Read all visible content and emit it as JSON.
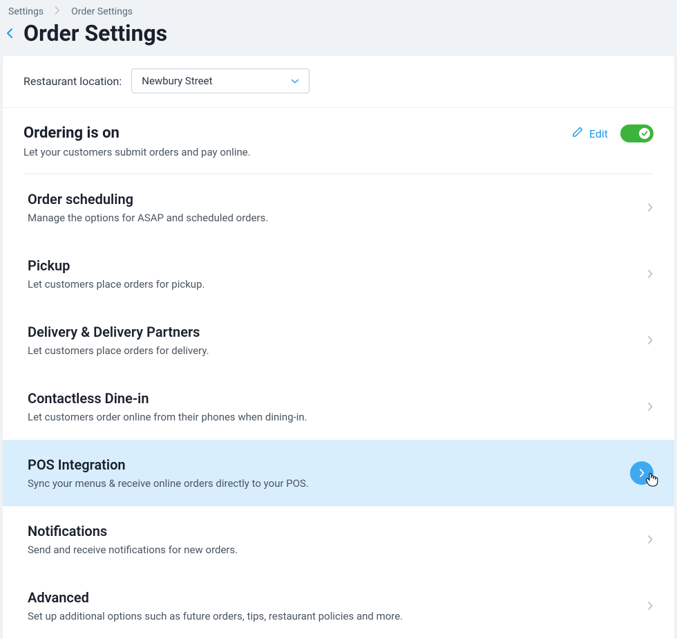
{
  "breadcrumb": {
    "parent": "Settings",
    "current": "Order Settings"
  },
  "title": "Order Settings",
  "location": {
    "label": "Restaurant location:",
    "value": "Newbury Street"
  },
  "ordering": {
    "header": "Ordering is on",
    "sub": "Let your customers submit orders and pay online.",
    "edit_label": "Edit",
    "toggle_on": true
  },
  "rows": [
    {
      "title": "Order scheduling",
      "sub": "Manage the options for ASAP and scheduled orders.",
      "highlight": false
    },
    {
      "title": "Pickup",
      "sub": "Let customers place orders for pickup.",
      "highlight": false
    },
    {
      "title": "Delivery & Delivery Partners",
      "sub": "Let customers place orders for delivery.",
      "highlight": false
    },
    {
      "title": "Contactless Dine-in",
      "sub": "Let customers order online from their phones when dining-in.",
      "highlight": false
    },
    {
      "title": "POS Integration",
      "sub": "Sync your menus & receive online orders directly to your POS.",
      "highlight": true
    },
    {
      "title": "Notifications",
      "sub": "Send and receive notifications for new orders.",
      "highlight": false
    },
    {
      "title": "Advanced",
      "sub": "Set up additional options such as future orders, tips, restaurant policies and more.",
      "highlight": false
    }
  ]
}
